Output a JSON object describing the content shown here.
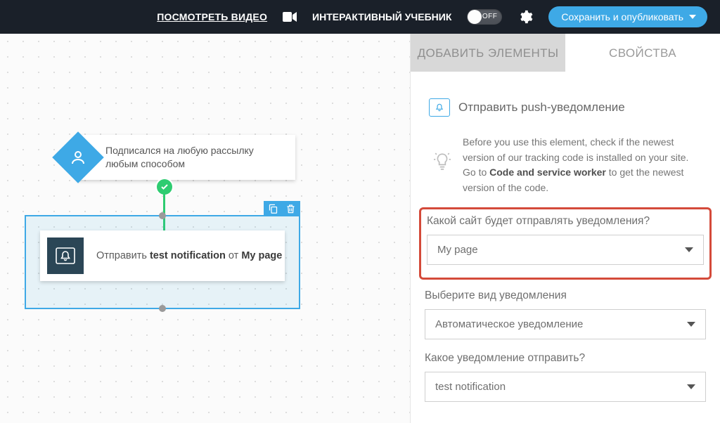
{
  "topbar": {
    "video_link": "ПОСМОТРЕТЬ ВИДЕО",
    "tutorial_label": "ИНТЕРАКТИВНЫЙ УЧЕБНИК",
    "toggle_state": "OFF",
    "publish_label": "Сохранить и опубликовать"
  },
  "canvas": {
    "trigger_text": "Подписался на любую рассылку любым способом",
    "action_prefix": "Отправить ",
    "action_bold1": "test notification",
    "action_mid": " от ",
    "action_bold2": "My page"
  },
  "panel": {
    "tab_add": "ДОБАВИТЬ ЭЛЕМЕНТЫ",
    "tab_props": "СВОЙСТВА",
    "title": "Отправить push-уведомление",
    "hint_before": "Before you use this element, check if the newest version of our tracking code is installed on your site. Go to ",
    "hint_bold": "Code and service worker",
    "hint_after": " to get the newest version of the code.",
    "field1_label": "Какой сайт будет отправлять уведомления?",
    "field1_value": "My page",
    "field2_label": "Выберите вид уведомления",
    "field2_value": "Автоматическое уведомление",
    "field3_label": "Какое уведомление отправить?",
    "field3_value": "test notification"
  }
}
